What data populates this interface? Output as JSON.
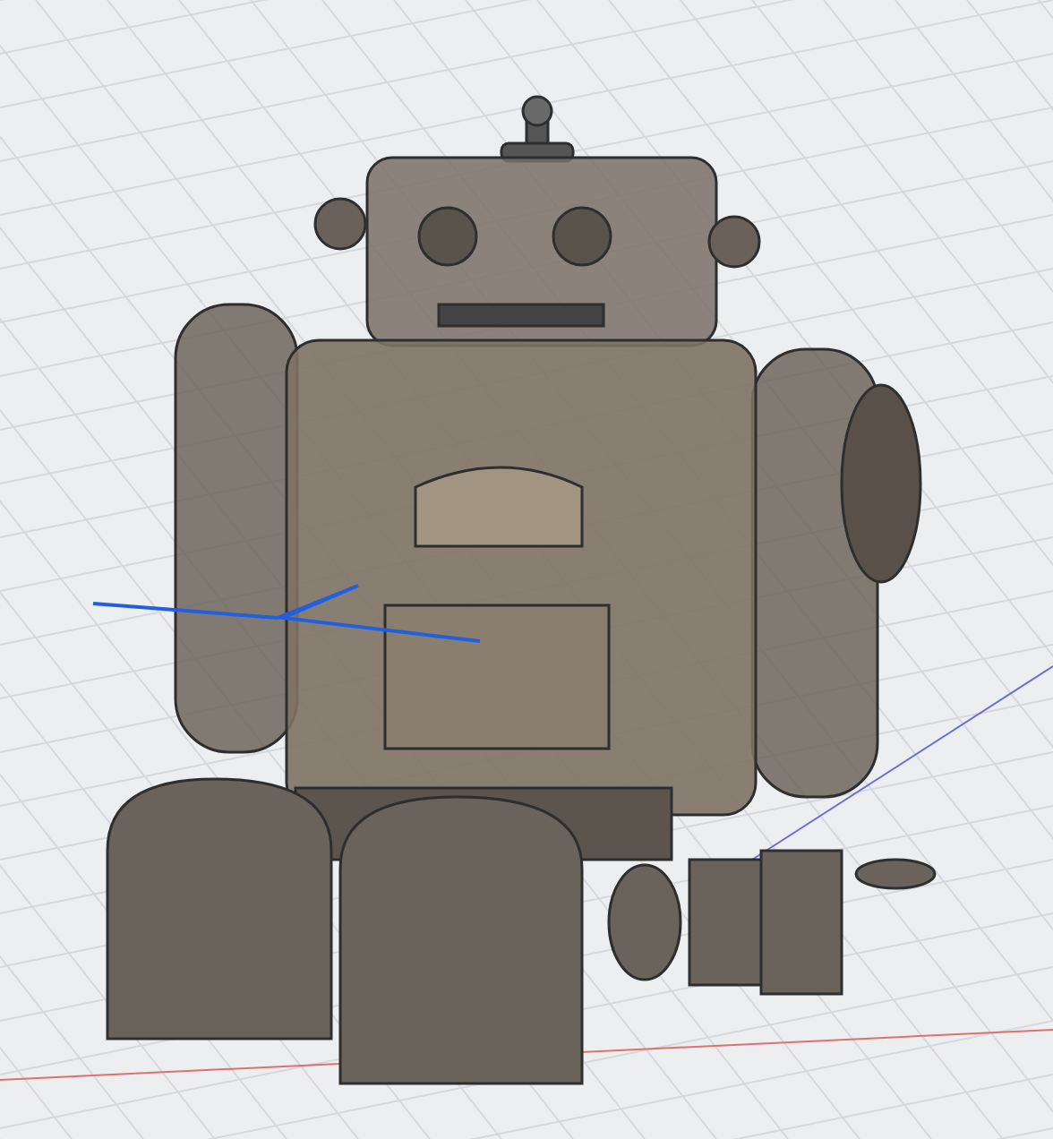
{
  "viewport": {
    "model_shown": true
  }
}
